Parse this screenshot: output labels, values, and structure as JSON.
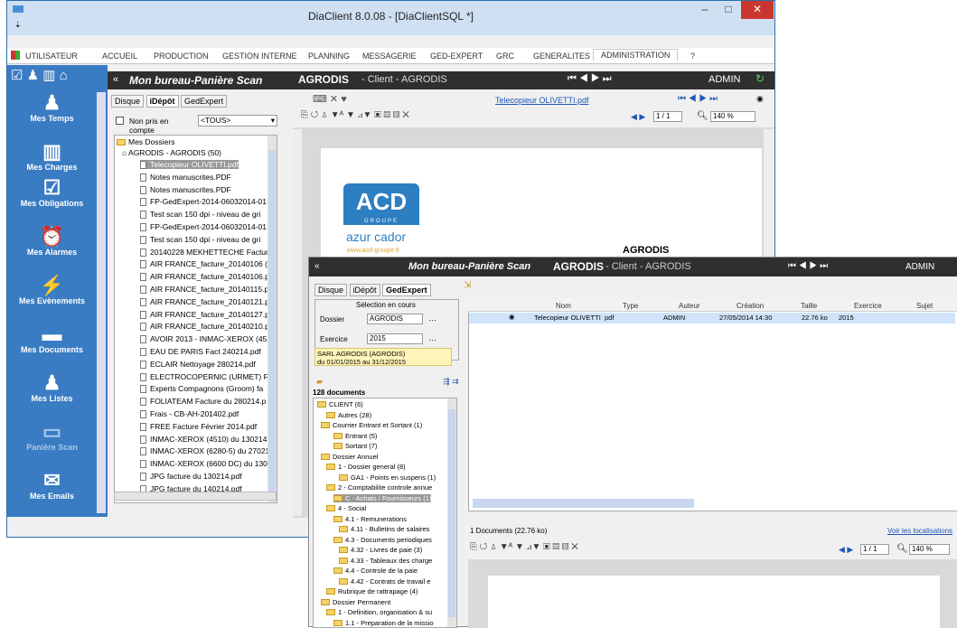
{
  "window": {
    "title": "DiaClient 8.0.08 - [DiaClientSQL *]",
    "minimize": "–",
    "maximize": "□",
    "close": "✕",
    "qa": "⇣"
  },
  "menu": [
    "UTILISATEUR",
    "ACCUEIL",
    "PRODUCTION",
    "GESTION INTERNE",
    "PLANNING",
    "MESSAGERIE",
    "GED-EXPERT",
    "GRC",
    "GENERALITES",
    "ADMINISTRATION",
    "?"
  ],
  "header": {
    "title": "Mon bureau-Panière Scan",
    "client_bold": "AGRODIS",
    "client_rest": "- Client - AGRODIS",
    "user": "ADMIN"
  },
  "sidebar": [
    "Mes Temps",
    "Mes Charges",
    "Mes Obligations",
    "Mes Alarmes",
    "Mes Evènements",
    "Mes Documents",
    "Mes Listes",
    "Panière Scan",
    "Mes Emails"
  ],
  "tabs": {
    "disque": "Disque",
    "idepot": "iDépôt",
    "gedexpert": "GedExpert"
  },
  "filter": {
    "checkbox_label": "Non pris en compte",
    "select_value": "<TOUS>"
  },
  "tree": {
    "root": "Mes Dossiers",
    "client": "AGRODIS - AGRODIS  (50)",
    "files": [
      "Telecopieur OLIVETTI.pdf",
      "Notes manuscrites.PDF",
      "Notes manuscrites.PDF",
      "FP-GedExpert-2014-06032014-01",
      "Test scan 150 dpi - niveau de gri",
      "FP-GedExpert-2014-06032014-01",
      "Test scan 150 dpi - niveau de gri",
      "20140228 MEKHETTECHE Facture",
      "AIR FRANCE_facture_20140106 (2",
      "AIR FRANCE_facture_20140106.p",
      "AIR FRANCE_facture_20140115.p",
      "AIR FRANCE_facture_20140121.p",
      "AIR FRANCE_facture_20140127.p",
      "AIR FRANCE_facture_20140210.p",
      "AVOIR 2013 - INMAC-XEROX (451",
      "EAU DE PARIS Fact 240214.pdf",
      "ECLAIR Nettoyage 280214.pdf",
      "ELECTROCOPERNIC (URMET) Fact",
      "Experts Compagnons (Groom) fa",
      "FOLIATEAM Facture du 280214.p",
      "Frais - CB-AH-201402.pdf",
      "FREE Facture Février 2014.pdf",
      "INMAC-XEROX (4510) du 130214.",
      "INMAC-XEROX (6280-5) du 27021",
      "INMAC-XEROX (6600 DC) du 1302",
      "JPG facture du 130214.pdf",
      "JPG facture du 140214.pdf"
    ]
  },
  "viewer": {
    "filename": "Telecopieur OLIVETTI.pdf",
    "page": "1 / 1",
    "zoom": "140 %",
    "doc_title": "AGRODIS",
    "logo_top": "ACD",
    "logo_sub": "GROUPE",
    "logo_name": "azur cador",
    "logo_url": "www.acd-groupe.fr"
  },
  "ged": {
    "selection": "Sélection en cours",
    "dossier_label": "Dossier",
    "dossier_value": "AGRODIS",
    "exercice_label": "Exercice",
    "exercice_value": "2015",
    "info_line1": "SARL AGRODIS (AGRODIS)",
    "info_line2": "du 01/01/2015 au 31/12/2015",
    "count": "128 documents",
    "tree": [
      "CLIENT (6)",
      "Autres (28)",
      "Courrier Entrant et Sortant (1)",
      "Entrant (5)",
      "Sortant (7)",
      "Dossier Annuel",
      "1 - Dossier general (8)",
      "GA1 - Points en suspens (1)",
      "2 - Comptabilite controle annue",
      "C - Achats / Fournisseurs (1)",
      "4 - Social",
      "4.1 - Remunerations",
      "4.11 - Bulletins de salaires",
      "4.3 - Documents periodiques",
      "4.32 - Livres de paie (3)",
      "4.33 - Tableaux des charge",
      "4.4 - Controle de la paie",
      "4.42 - Contrats de travail e",
      "Rubrique de rattrapage (4)",
      "Dossier Permanent",
      "1 - Definition, organisation & su",
      "1.1 - Preparation de la missio"
    ],
    "columns": [
      "Nom",
      "Type",
      "Auteur",
      "Création",
      "Taille",
      "Exercice",
      "Sujet"
    ],
    "row": {
      "nom": "Telecopieur OLIVETTI",
      "type": "pdf",
      "auteur": "ADMIN",
      "creation": "27/05/2014 14:30",
      "taille": "22.76 ko",
      "exercice": "2015"
    },
    "footer": "1 Documents (22.76 ko)",
    "link": "Voir les localisations"
  }
}
